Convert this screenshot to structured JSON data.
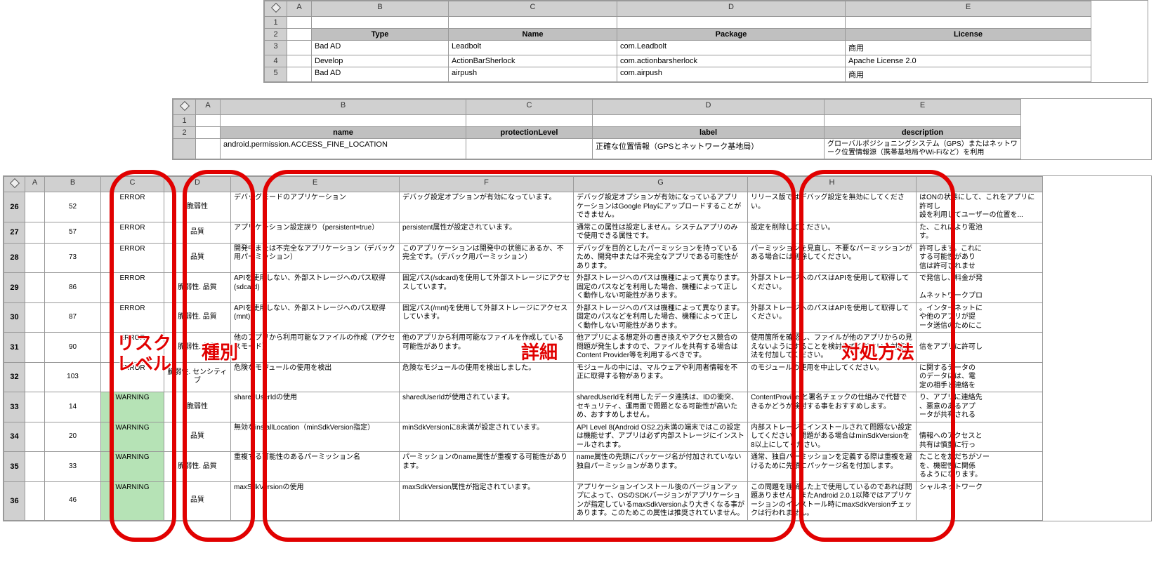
{
  "layer1": {
    "cols": [
      "A",
      "B",
      "C",
      "D",
      "E"
    ],
    "header": {
      "B": "Type",
      "C": "Name",
      "D": "Package",
      "E": "License"
    },
    "rows": [
      {
        "r": "3",
        "B": "Bad AD",
        "C": "Leadbolt",
        "D": "com.Leadbolt",
        "E": "商用"
      },
      {
        "r": "4",
        "B": "Develop",
        "C": "ActionBarSherlock",
        "D": "com.actionbarsherlock",
        "E": "Apache License 2.0"
      },
      {
        "r": "5",
        "B": "Bad AD",
        "C": "airpush",
        "D": "com.airpush",
        "E": "商用"
      }
    ],
    "rownums": [
      "1",
      "2",
      "3",
      "4",
      "5"
    ]
  },
  "layer2": {
    "cols": [
      "A",
      "B",
      "C",
      "D",
      "E"
    ],
    "header": {
      "B": "name",
      "C": "protectionLevel",
      "D": "label",
      "E": "description"
    },
    "row": {
      "B": "android.permission.ACCESS_FINE_LOCATION",
      "C": "",
      "D": "正確な位置情報（GPSとネットワーク基地局）",
      "E": "グローバルポジショニングシステム（GPS）またはネットワーク位置情報源（携帯基地局やWi-Fiなど）を利用"
    },
    "rownums": [
      "1",
      "2"
    ],
    "overflow": [
      "はONの状態にして、これをアプリに許可し",
      "設を利用してユーザーの位置を...",
      "た、これにより電池",
      "す。",
      "許可します。これに",
      "する可能性があり",
      "信は許可されませ",
      "で発信し、料金が発",
      "",
      "ムネットワークプロ",
      "。インターネットに",
      "や他のアプリが提",
      "ータ送信のためにこ",
      "",
      "信をアプリに許可し",
      "",
      "に関するデータの",
      "のデータには、電",
      "定の相手と連絡を",
      "り、アプリに連絡先",
      "、悪意のあるアプ",
      "ータが共有される",
      "",
      "情報へのアクセスと",
      "共有は慎重に行っ",
      "たことを友だちがソー",
      "を、機密性に関係",
      "るようになります。",
      "シャルネットワーク"
    ]
  },
  "layer3": {
    "cols": [
      "A",
      "B",
      "C",
      "D",
      "E",
      "F",
      "G",
      "H"
    ],
    "rows": [
      {
        "r": "26",
        "B": "52",
        "C": "ERROR",
        "D": "脆弱性",
        "E": "デバッグモードのアプリケーション",
        "F": "デバッグ設定オプションが有効になっています。",
        "G": "デバッグ設定オプションが有効になっているアプリケーションはGoogle Playにアップロードすることができません。",
        "H": "リリース版ではデバッグ設定を無効にしてください。"
      },
      {
        "r": "27",
        "B": "57",
        "C": "ERROR",
        "D": "品質",
        "E": "アプリケーション設定誤り（persistent=true）",
        "F": "persistent属性が設定されています。",
        "G": "通常この属性は設定しません。システムアプリのみで使用できる属性です。",
        "H": "設定を削除してください。"
      },
      {
        "r": "28",
        "B": "73",
        "C": "ERROR",
        "D": "品質",
        "E": "開発中または不完全なアプリケーション（デバック用パーミッション）",
        "F": "このアプリケーションは開発中の状態にあるか、不完全です。（デバック用パーミッション）",
        "G": "デバッグを目的としたパーミッションを持っているため、開発中または不完全なアプリである可能性があります。",
        "H": "パーミッションを見直し、不要なパーミッションがある場合には削除してください。"
      },
      {
        "r": "29",
        "B": "86",
        "C": "ERROR",
        "D": "脆弱性. 品質",
        "E": "APIを使用しない、外部ストレージへのパス取得(sdcard)",
        "F": "固定パス(/sdcard)を使用して外部ストレージにアクセスしています。",
        "G": "外部ストレージへのパスは機種によって異なります。固定のパスなどを利用した場合、機種によって正しく動作しない可能性があります。",
        "H": "外部ストレージへのパスはAPIを使用して取得してください。"
      },
      {
        "r": "30",
        "B": "87",
        "C": "ERROR",
        "D": "脆弱性. 品質",
        "E": "APIを使用しない、外部ストレージへのパス取得(mnt)",
        "F": "固定パス(/mnt)を使用して外部ストレージにアクセスしています。",
        "G": "外部ストレージへのパスは機種によって異なります。固定のパスなどを利用した場合、機種によって正しく動作しない可能性があります。",
        "H": "外部ストレージへのパスはAPIを使用して取得してください。"
      },
      {
        "r": "31",
        "B": "90",
        "C": "ERROR",
        "D": "脆弱性. 品質",
        "E": "他のアプリから利用可能なファイルの作成（アクセスモード）",
        "F": "他のアプリから利用可能なファイルを作成している可能性があります。",
        "G": "他アプリによる想定外の書き換えやアクセス競合の問題が発生しますので、ファイルを共有する場合はContent Provider等を利用するべきです。",
        "H": "使用箇所を確認し、ファイルが他のアプリからの見えないようにすることを検討してください。対応方法を付加してください。"
      },
      {
        "r": "32",
        "B": "103",
        "C": "ERROR",
        "D": "脆弱性. センシティブ",
        "E": "危険なモジュールの使用を検出",
        "F": "危険なモジュールの使用を検出しました。",
        "G": "モジュールの中には、マルウェアや利用者情報を不正に取得する物があります。",
        "H": "のモジュールの使用を中止してください。"
      },
      {
        "r": "33",
        "B": "14",
        "C": "WARNING",
        "D": "脆弱性",
        "E": "sharedUserIdの使用",
        "F": "sharedUserIdが使用されています。",
        "G": "sharedUserIdを利用したデータ連携は、IDの衝突、セキュリティ、運用面で問題となる可能性が高いため、おすすめしません。",
        "H": "ContentProviderと署名チェックの仕組みで代替できるかどうか検討する事をおすすめします。"
      },
      {
        "r": "34",
        "B": "20",
        "C": "WARNING",
        "D": "品質",
        "E": "無効なinstallLocation（minSdkVersion指定）",
        "F": "minSdkVersionに8未満が設定されています。",
        "G": "API Level 8(Android OS2.2)未満の端末ではこの設定は機能せず、アプリは必ず内部ストレージにインストールされます。",
        "H": "内部ストレージにインストールされて問題ない設定してください。問題がある場合はminSdkVersionを8以上にしてください。"
      },
      {
        "r": "35",
        "B": "33",
        "C": "WARNING",
        "D": "脆弱性. 品質",
        "E": "重複する可能性のあるパーミッション名",
        "F": "パーミッションのname属性が重複する可能性があります。",
        "G": "name属性の先頭にパッケージ名が付加されていない独自パーミッションがあります。",
        "H": "通常、独自パーミッションを定義する際は重複を避けるために先頭にパッケージ名を付加します。"
      },
      {
        "r": "36",
        "B": "46",
        "C": "WARNING",
        "D": "品質",
        "E": "maxSdkVersionの使用",
        "F": "maxSdkVersion属性が指定されています。",
        "G": "アプリケーションインストール後のバージョンアップによって、OSのSDKバージョンがアプリケーションが指定しているmaxSdkVersionより大きくなる事があります。このためこの属性は推奨されていません。",
        "H": "この問題を理解した上で使用しているのであれば問題ありません。またAndroid 2.0.1以降ではアプリケーションのインストール時にmaxSdkVersionチェックは行われません。"
      }
    ]
  },
  "annotations": {
    "risk": "リスク\nレベル",
    "type": "種別",
    "detail": "詳細",
    "action": "対処方法"
  }
}
